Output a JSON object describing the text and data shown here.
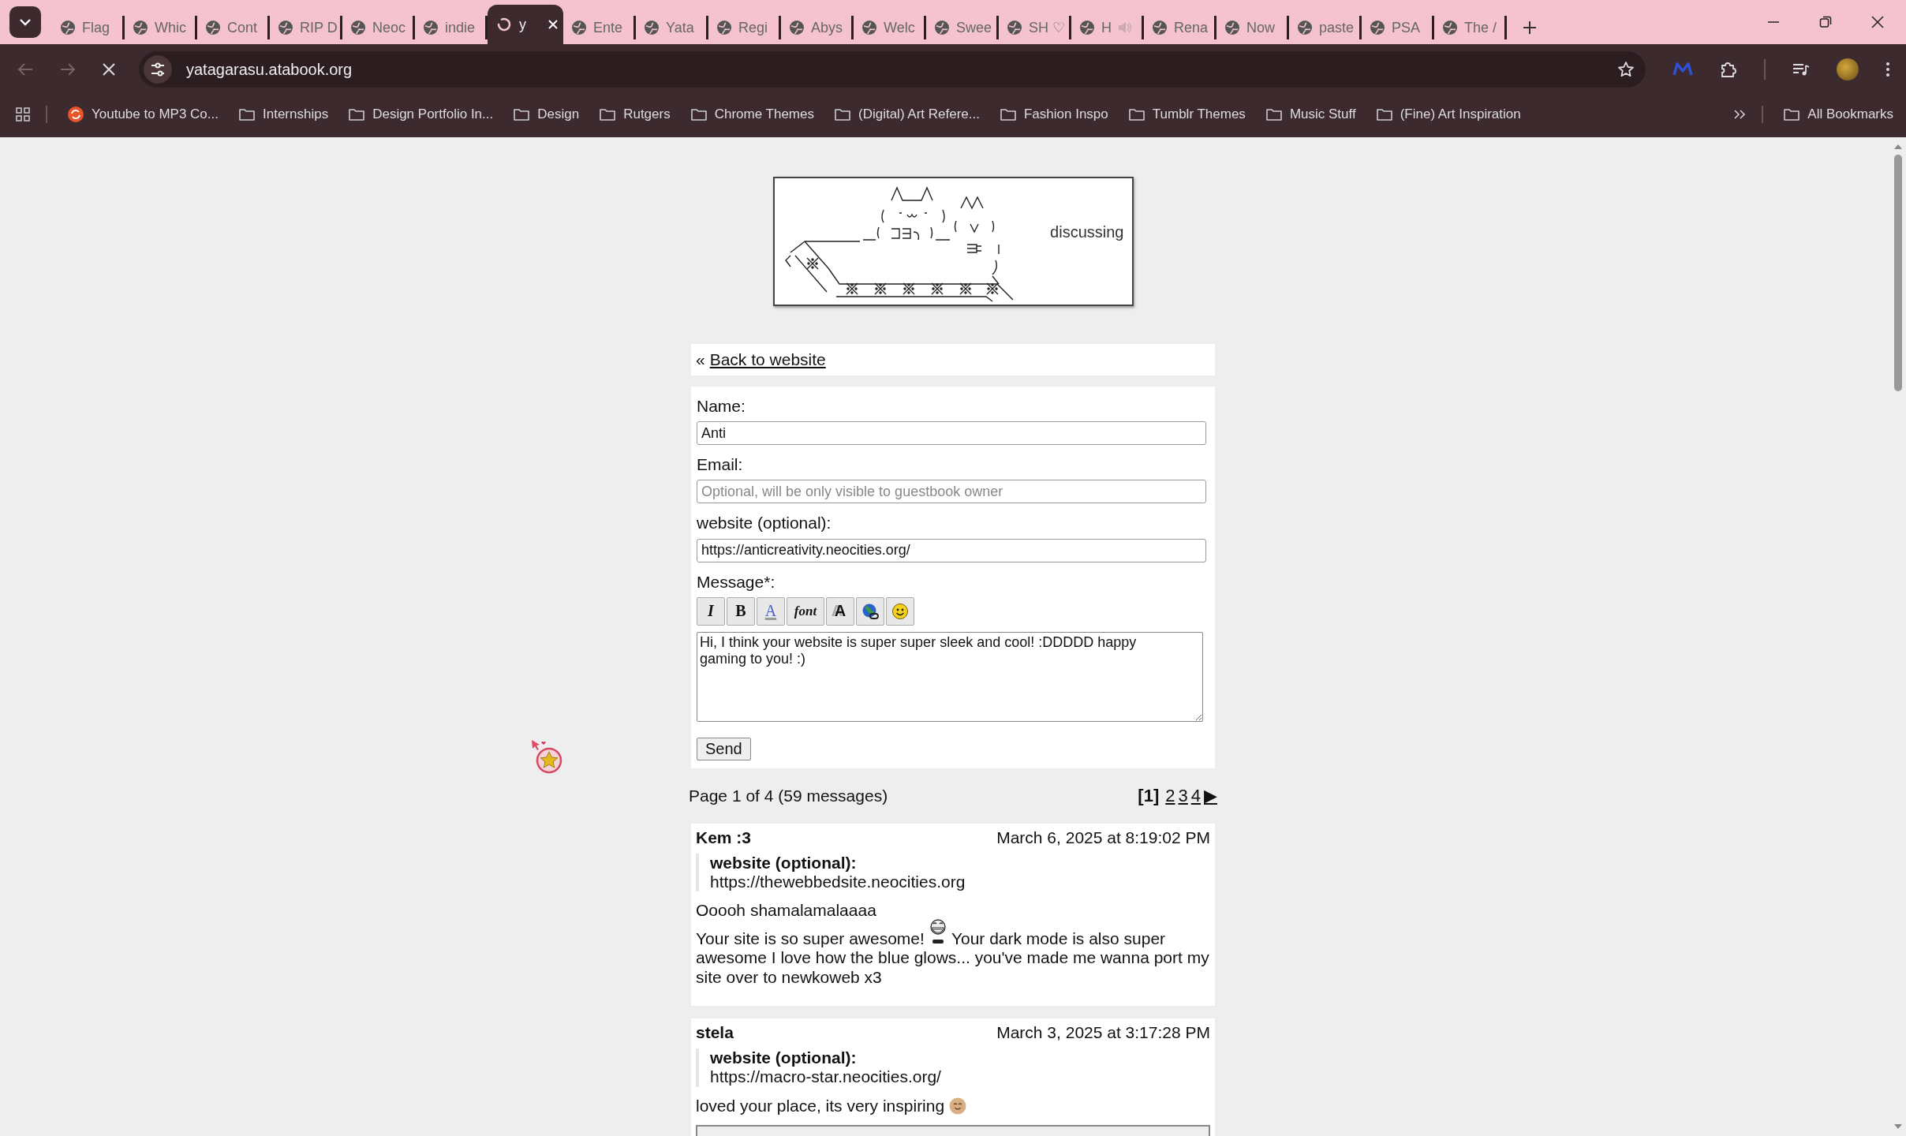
{
  "browser": {
    "tabs": [
      {
        "title": "Flag",
        "selected": false
      },
      {
        "title": "Whic",
        "selected": false
      },
      {
        "title": "Cont",
        "selected": false
      },
      {
        "title": "RIP D",
        "selected": false
      },
      {
        "title": "Neoc",
        "selected": false
      },
      {
        "title": "indie",
        "selected": false
      },
      {
        "title": "y",
        "selected": true
      },
      {
        "title": "Ente",
        "selected": false
      },
      {
        "title": "Yata",
        "selected": false
      },
      {
        "title": "Regi",
        "selected": false
      },
      {
        "title": "Abys",
        "selected": false
      },
      {
        "title": "Welc",
        "selected": false
      },
      {
        "title": "Swee",
        "selected": false
      },
      {
        "title": "SH ♡",
        "selected": false
      },
      {
        "title": "H",
        "selected": false,
        "audio": true
      },
      {
        "title": "Rena",
        "selected": false
      },
      {
        "title": "Now",
        "selected": false
      },
      {
        "title": "paste",
        "selected": false
      },
      {
        "title": "PSA",
        "selected": false
      },
      {
        "title": "The /",
        "selected": false
      }
    ],
    "loading": true,
    "url": "yatagarasu.atabook.org",
    "bookmarks": [
      {
        "kind": "site",
        "label": "Youtube to MP3 Co..."
      },
      {
        "kind": "folder",
        "label": "Internships"
      },
      {
        "kind": "folder",
        "label": "Design Portfolio In..."
      },
      {
        "kind": "folder",
        "label": "Design"
      },
      {
        "kind": "folder",
        "label": "Rutgers"
      },
      {
        "kind": "folder",
        "label": "Chrome Themes"
      },
      {
        "kind": "folder",
        "label": "(Digital) Art Refere..."
      },
      {
        "kind": "folder",
        "label": "Fashion Inspo"
      },
      {
        "kind": "folder",
        "label": "Tumblr Themes"
      },
      {
        "kind": "folder",
        "label": "Music Stuff"
      },
      {
        "kind": "folder",
        "label": "(Fine) Art Inspiration"
      }
    ],
    "all_bookmarks": "All Bookmarks"
  },
  "banner": {
    "caption": "discussing"
  },
  "back_link": {
    "prefix": "«",
    "label": "Back to website"
  },
  "form": {
    "fields": [
      {
        "kind": "input",
        "label": "Name:",
        "value": "Anti"
      },
      {
        "kind": "input",
        "label": "Email:",
        "placeholder": "Optional, will be only visible to guestbook owner"
      },
      {
        "kind": "input",
        "label": "website (optional):",
        "value": "https://anticreativity.neocities.org/"
      },
      {
        "kind": "textarea",
        "label": "Message*:",
        "value": "Hi, I think your website is super super sleek and cool! :DDDDD happy gaming to you! :)"
      }
    ],
    "toolbar": [
      {
        "kind": "italic",
        "label": "I"
      },
      {
        "kind": "bold",
        "label": "B"
      },
      {
        "kind": "color",
        "label": "A"
      },
      {
        "kind": "font",
        "label": "font"
      },
      {
        "kind": "size",
        "label": "A"
      },
      {
        "kind": "link"
      },
      {
        "kind": "emoji"
      }
    ],
    "submit": "Send"
  },
  "pagination": {
    "summary": "Page 1 of 4 (59 messages)",
    "pages": [
      {
        "label": "[1]",
        "selected": true
      },
      {
        "label": "2",
        "selected": false
      },
      {
        "label": "3",
        "selected": false
      },
      {
        "label": "4",
        "selected": false
      }
    ],
    "next": "▶"
  },
  "messages": [
    {
      "name": "Kem :3",
      "date": "March 6, 2025 at 8:19:02 PM",
      "field_label": "website (optional):",
      "field_value": "https://thewebbedsite.neocities.org",
      "paragraphs": [
        [
          {
            "kind": "text",
            "text": "Ooooh shamalamalaaaa"
          }
        ],
        [
          {
            "kind": "text",
            "text": "Your site is so super awesome!"
          },
          {
            "kind": "grin"
          },
          {
            "kind": "text",
            "text": "Your dark mode is also super"
          },
          {
            "kind": "line",
            "text": "awesome I love how the blue glows... you've made me wanna port my site over to newkoweb x3"
          }
        ]
      ]
    },
    {
      "name": "stela",
      "date": "March 3, 2025 at 3:17:28 PM",
      "field_label": "website (optional):",
      "field_value": "https://macro-star.neocities.org/",
      "paragraphs": [
        [
          {
            "kind": "text",
            "text": "loved your place, its very inspiring"
          },
          {
            "kind": "smile"
          }
        ]
      ],
      "frame": true
    }
  ]
}
